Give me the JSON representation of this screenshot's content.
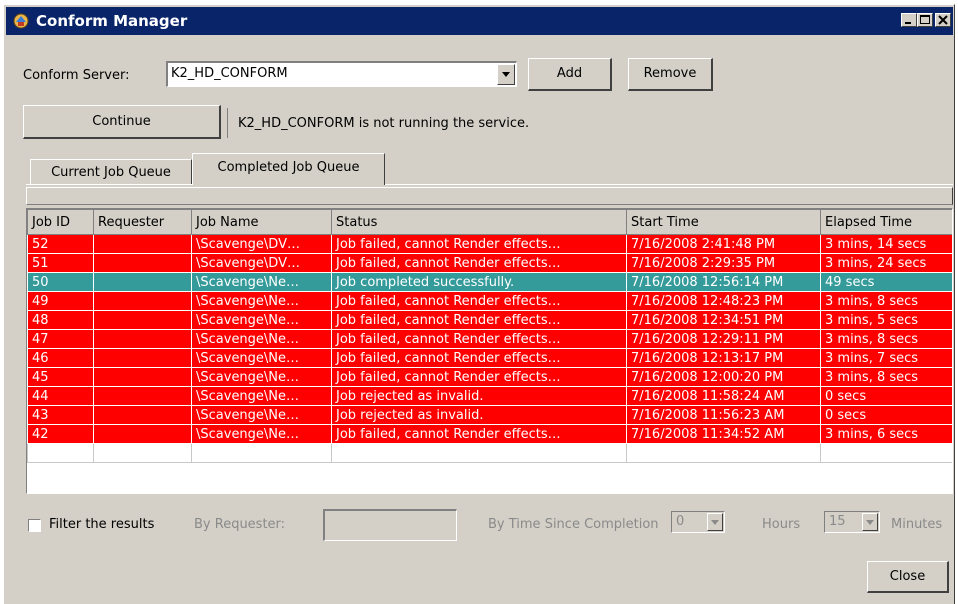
{
  "window": {
    "title": "Conform Manager"
  },
  "server": {
    "label": "Conform Server:",
    "selected": "K2_HD_CONFORM",
    "add_label": "Add",
    "remove_label": "Remove"
  },
  "continue_label": "Continue",
  "status_message": "K2_HD_CONFORM is not running the service.",
  "tabs": [
    {
      "label": "Current Job Queue",
      "active": false
    },
    {
      "label": "Completed Job Queue",
      "active": true
    }
  ],
  "grid": {
    "columns": [
      "Job ID",
      "Requester",
      "Job Name",
      "Status",
      "Start Time",
      "Elapsed Time"
    ],
    "rows": [
      {
        "job_id": "52",
        "requester": "",
        "job_name": "\\Scavenge\\DV…",
        "status": "Job failed, cannot Render effects…",
        "start_time": "7/16/2008 2:41:48 PM",
        "elapsed": "3 mins, 14 secs",
        "state": "failed"
      },
      {
        "job_id": "51",
        "requester": "",
        "job_name": "\\Scavenge\\DV…",
        "status": "Job failed, cannot Render effects…",
        "start_time": "7/16/2008 2:29:35 PM",
        "elapsed": "3 mins, 24 secs",
        "state": "failed"
      },
      {
        "job_id": "50",
        "requester": "",
        "job_name": "\\Scavenge\\Ne…",
        "status": "Job completed successfully.",
        "start_time": "7/16/2008 12:56:14 PM",
        "elapsed": "49 secs",
        "state": "success"
      },
      {
        "job_id": "49",
        "requester": "",
        "job_name": "\\Scavenge\\Ne…",
        "status": "Job failed, cannot Render effects…",
        "start_time": "7/16/2008 12:48:23 PM",
        "elapsed": "3 mins, 8 secs",
        "state": "failed"
      },
      {
        "job_id": "48",
        "requester": "",
        "job_name": "\\Scavenge\\Ne…",
        "status": "Job failed, cannot Render effects…",
        "start_time": "7/16/2008 12:34:51 PM",
        "elapsed": "3 mins, 5 secs",
        "state": "failed"
      },
      {
        "job_id": "47",
        "requester": "",
        "job_name": "\\Scavenge\\Ne…",
        "status": "Job failed, cannot Render effects…",
        "start_time": "7/16/2008 12:29:11 PM",
        "elapsed": "3 mins, 8 secs",
        "state": "failed"
      },
      {
        "job_id": "46",
        "requester": "",
        "job_name": "\\Scavenge\\Ne…",
        "status": "Job failed, cannot Render effects…",
        "start_time": "7/16/2008 12:13:17 PM",
        "elapsed": "3 mins, 7 secs",
        "state": "failed"
      },
      {
        "job_id": "45",
        "requester": "",
        "job_name": "\\Scavenge\\Ne…",
        "status": "Job failed, cannot Render effects…",
        "start_time": "7/16/2008 12:00:20 PM",
        "elapsed": "3 mins, 8 secs",
        "state": "failed"
      },
      {
        "job_id": "44",
        "requester": "",
        "job_name": "\\Scavenge\\Ne…",
        "status": "Job rejected as invalid.",
        "start_time": "7/16/2008 11:58:24 AM",
        "elapsed": "0 secs",
        "state": "failed"
      },
      {
        "job_id": "43",
        "requester": "",
        "job_name": "\\Scavenge\\Ne…",
        "status": "Job rejected as invalid.",
        "start_time": "7/16/2008 11:56:23 AM",
        "elapsed": "0 secs",
        "state": "failed"
      },
      {
        "job_id": "42",
        "requester": "",
        "job_name": "\\Scavenge\\Ne…",
        "status": "Job failed, cannot Render effects…",
        "start_time": "7/16/2008 11:34:52 AM",
        "elapsed": "3 mins, 6 secs",
        "state": "failed"
      }
    ]
  },
  "filter": {
    "checkbox_label": "Filter the results",
    "checked": false,
    "requester_label": "By Requester:",
    "requester_value": "",
    "time_label": "By Time Since Completion",
    "hours_value": "0",
    "hours_label": "Hours",
    "minutes_value": "15",
    "minutes_label": "Minutes"
  },
  "close_label": "Close",
  "colors": {
    "titlebar": "#0a246a",
    "failed_row": "#ff0000",
    "success_row": "#359b9a",
    "dialog": "#d4d0c8"
  },
  "icons": {
    "app": "conform-app-icon",
    "minimize": "minimize-icon",
    "maximize": "maximize-icon",
    "close": "close-icon",
    "dropdown": "chevron-down-icon"
  }
}
